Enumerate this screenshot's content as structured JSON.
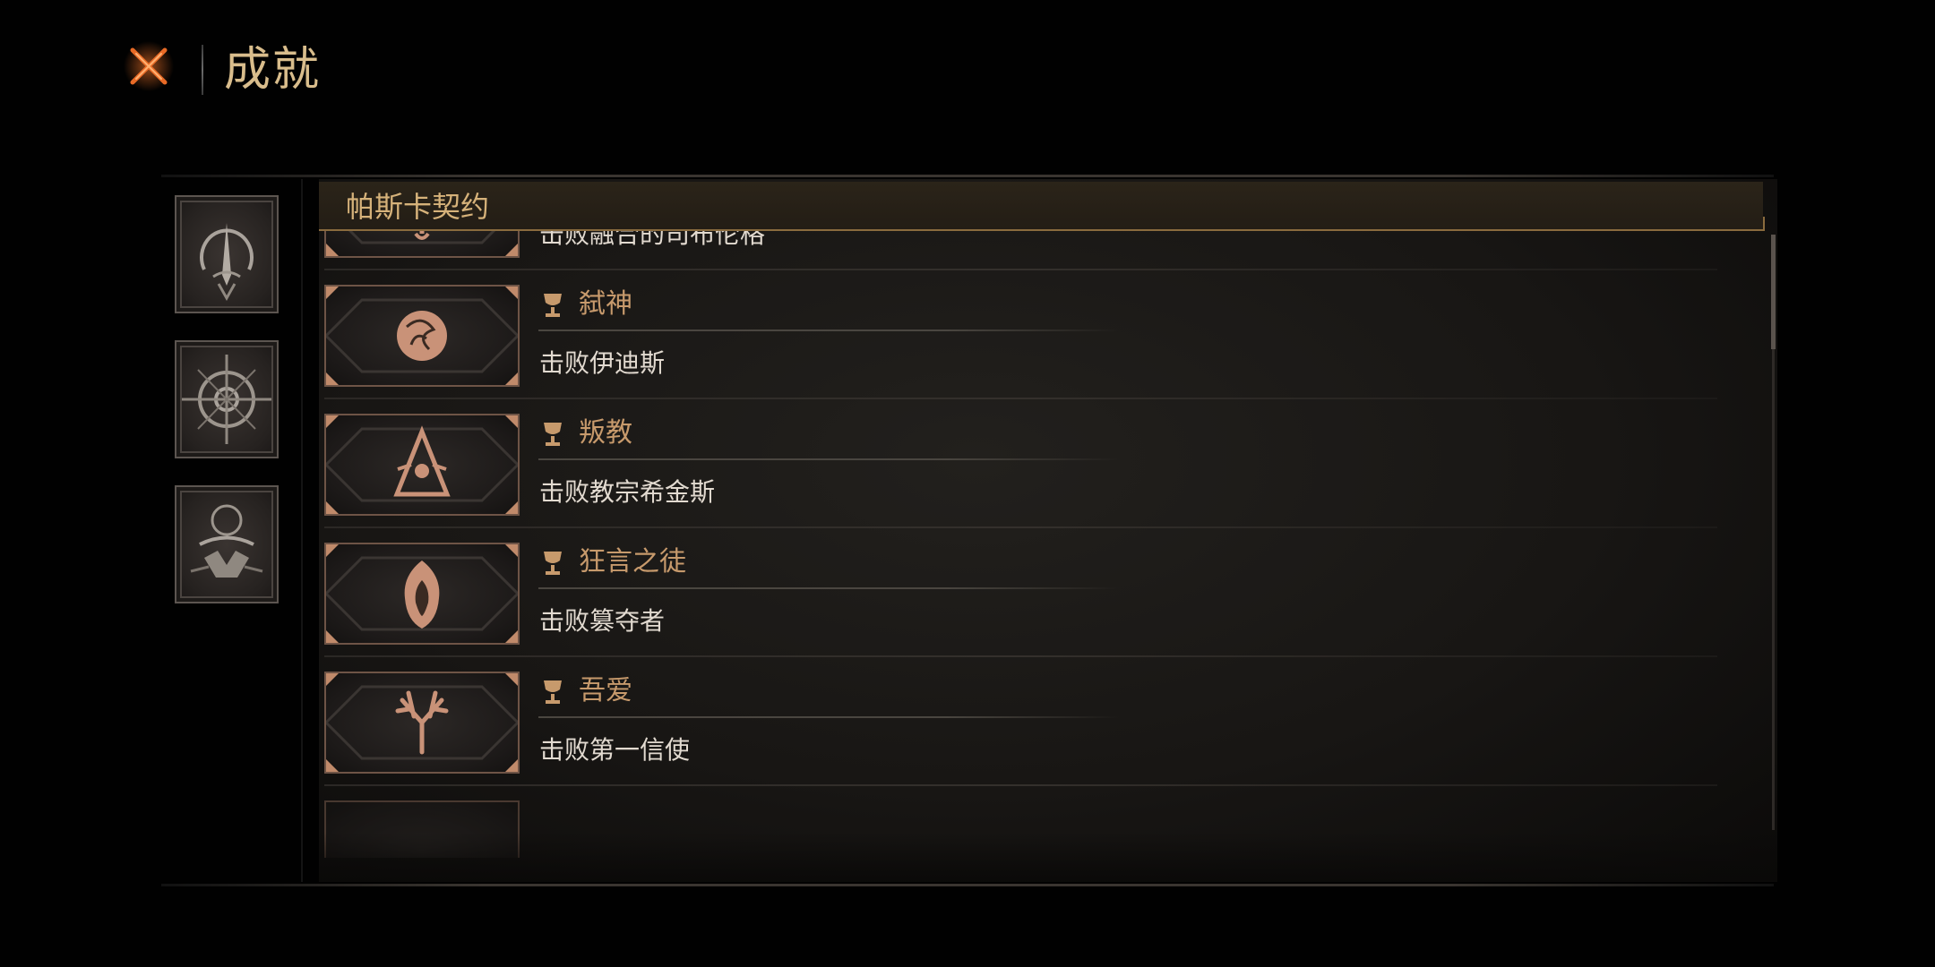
{
  "header": {
    "title": "成就",
    "close_icon": "close-x-icon"
  },
  "categories": [
    {
      "name": "cat-tab-1",
      "icon": "trident-emblem-icon",
      "active": true
    },
    {
      "name": "cat-tab-2",
      "icon": "compass-rune-icon",
      "active": false
    },
    {
      "name": "cat-tab-3",
      "icon": "beast-sigil-icon",
      "active": false
    }
  ],
  "section": {
    "title": "帕斯卡契约"
  },
  "achievements": [
    {
      "title": "",
      "desc": "击败融合的司布伦格",
      "icon": "antler-skull-icon"
    },
    {
      "title": "弑神",
      "desc": "击败伊迪斯",
      "icon": "tangled-orb-icon"
    },
    {
      "title": "叛教",
      "desc": "击败教宗希金斯",
      "icon": "triangle-eye-icon"
    },
    {
      "title": "狂言之徒",
      "desc": "击败篡夺者",
      "icon": "hooded-figure-icon"
    },
    {
      "title": "吾爱",
      "desc": "击败第一信使",
      "icon": "antlers-icon"
    },
    {
      "title": "",
      "desc": "",
      "icon": "hidden-icon"
    }
  ],
  "colors": {
    "title": "#d9bd8c",
    "accent": "#c79a6c",
    "frame": "#6e5446",
    "close": "#e0652a"
  }
}
